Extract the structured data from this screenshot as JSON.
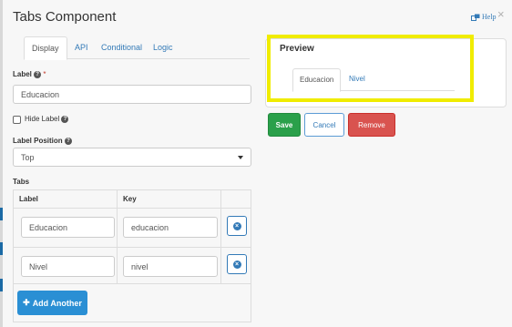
{
  "title": "Tabs Component",
  "help": {
    "label": "Help",
    "close": "×"
  },
  "tabs": [
    "Display",
    "API",
    "Conditional",
    "Logic"
  ],
  "label_field": {
    "label": "Label",
    "required_mark": "*",
    "value": "Educacion"
  },
  "hide_label": {
    "label": "Hide Label",
    "checked": false
  },
  "label_position": {
    "label": "Label Position",
    "value": "Top"
  },
  "tabs_grid": {
    "title": "Tabs",
    "headers": [
      "Label",
      "Key"
    ],
    "rows": [
      {
        "label": "Educacion",
        "key": "educacion"
      },
      {
        "label": "Nivel",
        "key": "nivel"
      }
    ],
    "add_label": "Add Another"
  },
  "preview": {
    "title": "Preview",
    "tabs": [
      "Educacion",
      "Nivel"
    ]
  },
  "actions": {
    "save": "Save",
    "cancel": "Cancel",
    "remove": "Remove"
  },
  "colors": {
    "accent": "#337ab7",
    "save": "#2aa04a",
    "remove": "#d9534f",
    "highlight": "#f0ec00"
  },
  "icons": [
    "help-icon",
    "close-icon",
    "question-icon",
    "remove-row-icon",
    "plus-icon",
    "dropdown-caret-icon"
  ]
}
